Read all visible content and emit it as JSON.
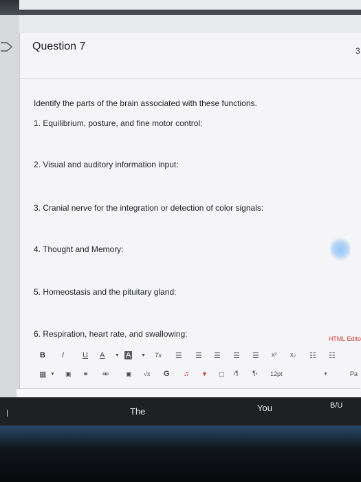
{
  "question": {
    "title": "Question 7",
    "points": "3",
    "prompt": "Identify the parts of the brain associated with these functions.",
    "items": [
      "1. Equilibrium, posture, and fine motor control:",
      "2. Visual and auditory information input:",
      "3. Cranial nerve for the integration or detection of color signals:",
      "4. Thought and Memory:",
      "5. Homeostasis and the pituitary gland:",
      "6. Respiration, heart rate, and swallowing:"
    ]
  },
  "editor": {
    "html_editor_label": "HTML Editor",
    "bold_label": "B",
    "italic_label": "I",
    "underline_label": "U",
    "font_color_label": "A",
    "highlight_label": "A",
    "clear_format_label": "Tx",
    "superscript_label": "x²",
    "subscript_label": "x₂",
    "font_size": "12pt",
    "paragraph_label": "Pa"
  },
  "taskbar": {
    "item1": "The",
    "item2": "You",
    "item3": "B/U"
  },
  "colors": {
    "html_editor_link": "#d44040",
    "card_background": "#f5f5f7",
    "taskbar_background": "#1f2022"
  }
}
